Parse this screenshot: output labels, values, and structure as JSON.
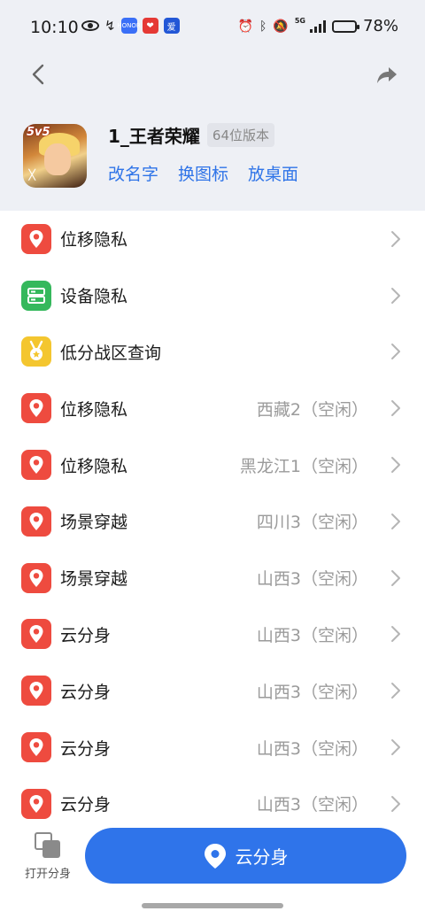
{
  "status_bar": {
    "time": "10:10",
    "battery": "78%",
    "battery_level": 0.78,
    "network": "5G",
    "left_apps": [
      "HONOR",
      "❤",
      "爱"
    ]
  },
  "app": {
    "name": "1_王者荣耀",
    "badge": "64位版本",
    "icon_text": "5v5",
    "actions": [
      "改名字",
      "换图标",
      "放桌面"
    ]
  },
  "list": [
    {
      "icon": "location-pin-icon",
      "color": "#ee4b3f",
      "title": "位移隐私",
      "value": ""
    },
    {
      "icon": "device-icon",
      "color": "#35b85c",
      "title": "设备隐私",
      "value": ""
    },
    {
      "icon": "medal-icon",
      "color": "#f4c62f",
      "title": "低分战区查询",
      "value": ""
    },
    {
      "icon": "location-pin-icon",
      "color": "#ee4b3f",
      "title": "位移隐私",
      "value": "西藏2（空闲）"
    },
    {
      "icon": "location-pin-icon",
      "color": "#ee4b3f",
      "title": "位移隐私",
      "value": "黑龙江1（空闲）"
    },
    {
      "icon": "location-pin-icon",
      "color": "#ee4b3f",
      "title": "场景穿越",
      "value": "四川3（空闲）"
    },
    {
      "icon": "location-pin-icon",
      "color": "#ee4b3f",
      "title": "场景穿越",
      "value": "山西3（空闲）"
    },
    {
      "icon": "location-pin-icon",
      "color": "#ee4b3f",
      "title": "云分身",
      "value": "山西3（空闲）"
    },
    {
      "icon": "location-pin-icon",
      "color": "#ee4b3f",
      "title": "云分身",
      "value": "山西3（空闲）"
    },
    {
      "icon": "location-pin-icon",
      "color": "#ee4b3f",
      "title": "云分身",
      "value": "山西3（空闲）"
    },
    {
      "icon": "location-pin-icon",
      "color": "#ee4b3f",
      "title": "云分身",
      "value": "山西3（空闲）"
    }
  ],
  "bottom": {
    "open_clone_label": "打开分身",
    "main_button_label": "云分身"
  },
  "colors": {
    "accent": "#2f74ea",
    "header_bg": "#eef0f5"
  }
}
